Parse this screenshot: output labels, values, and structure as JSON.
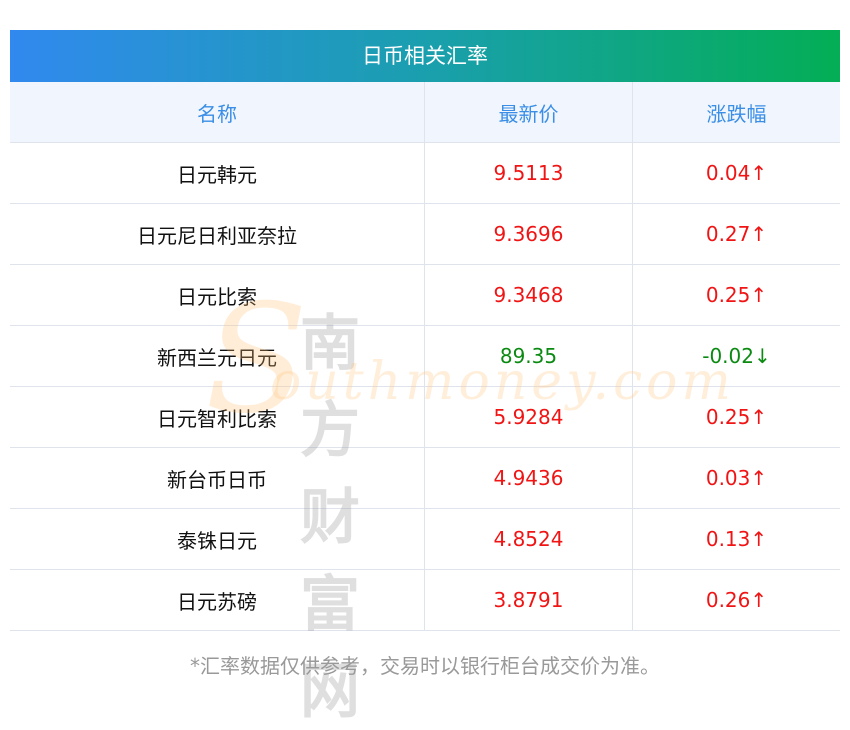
{
  "title": "日币相关汇率",
  "columns": [
    "名称",
    "最新价",
    "涨跌幅"
  ],
  "rows": [
    {
      "name": "日元韩元",
      "price": "9.5113",
      "change": "0.04↑",
      "dir": "up"
    },
    {
      "name": "日元尼日利亚奈拉",
      "price": "9.3696",
      "change": "0.27↑",
      "dir": "up"
    },
    {
      "name": "日元比索",
      "price": "9.3468",
      "change": "0.25↑",
      "dir": "up"
    },
    {
      "name": "新西兰元日元",
      "price": "89.35",
      "change": "-0.02↓",
      "dir": "down"
    },
    {
      "name": "日元智利比索",
      "price": "5.9284",
      "change": "0.25↑",
      "dir": "up"
    },
    {
      "name": "新台币日币",
      "price": "4.9436",
      "change": "0.03↑",
      "dir": "up"
    },
    {
      "name": "泰铢日元",
      "price": "4.8524",
      "change": "0.13↑",
      "dir": "up"
    },
    {
      "name": "日元苏磅",
      "price": "3.8791",
      "change": "0.26↑",
      "dir": "up"
    }
  ],
  "footnote": "*汇率数据仅供参考，交易时以银行柜台成交价为准。",
  "watermark": {
    "cn": "南方财富网",
    "en": "outhmoney.com",
    "s": "S"
  },
  "colors": {
    "up": "#f01414",
    "down": "#0b8a12",
    "header": "#3a8ee6"
  }
}
